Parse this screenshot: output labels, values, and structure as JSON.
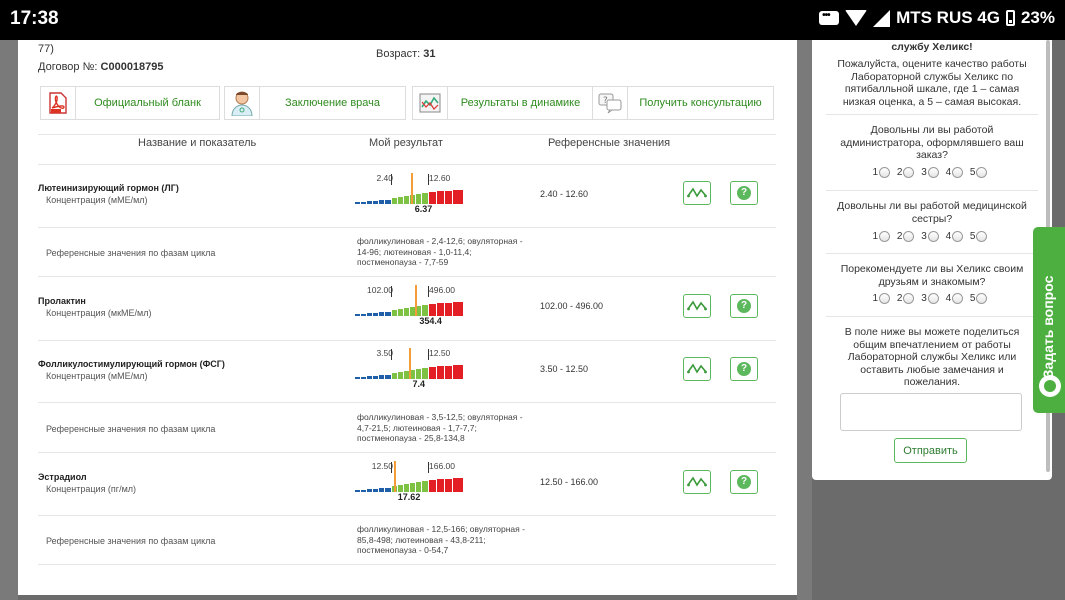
{
  "statusbar": {
    "time": "17:38",
    "carrier": "MTS RUS 4G",
    "battery": "23%"
  },
  "patient": {
    "top_line": "77)",
    "contract_label": "Договор №:",
    "contract_value": "С000018795",
    "age_label": "Возраст:",
    "age_value": "31"
  },
  "toolbar": [
    {
      "label": "Официальный бланк",
      "icon": "pdf-icon"
    },
    {
      "label": "Заключение врача",
      "icon": "doctor-icon"
    },
    {
      "label": "Результаты в динамике",
      "icon": "chart-icon"
    },
    {
      "label": "Получить консультацию",
      "icon": "chat-icon"
    }
  ],
  "columns": {
    "name": "Название и показатель",
    "result": "Мой результат",
    "reference": "Референсные значения"
  },
  "tests": [
    {
      "name": "Лютеинизирующий гормон (ЛГ)",
      "sub": "Концентрация (мМЕ/мл)",
      "low": "2.40",
      "high": "12.60",
      "value": "6.37",
      "value_fraction": 0.52,
      "reference": "2.40 - 12.60",
      "phase_label": "Референсные значения по фазам цикла",
      "phase_text": "фолликулиновая - 2,4-12,6; овуляторная - 14-96; лютеиновая - 1,0-11,4; постменопауза - 7,7-59"
    },
    {
      "name": "Пролактин",
      "sub": "Концентрация (мкМЕ/мл)",
      "low": "102.00",
      "high": "496.00",
      "value": "354.4",
      "value_fraction": 0.65,
      "reference": "102.00 - 496.00"
    },
    {
      "name": "Фолликулостимулирующий гормон (ФСГ)",
      "sub": "Концентрация (мМЕ/мл)",
      "low": "3.50",
      "high": "12.50",
      "value": "7.4",
      "value_fraction": 0.46,
      "reference": "3.50 - 12.50",
      "phase_label": "Референсные значения по фазам цикла",
      "phase_text": "фолликулиновая - 3,5-12,5; овуляторная - 4,7-21,5; лютеиновая - 1,7-7,7; постменопауза - 25,8-134,8"
    },
    {
      "name": "Эстрадиол",
      "sub": "Концентрация (пг/мл)",
      "low": "12.50",
      "high": "166.00",
      "value": "17.62",
      "value_fraction": 0.05,
      "reference": "12.50 - 166.00",
      "phase_label": "Референсные значения по фазам цикла",
      "phase_text": "фолликулиновая - 12,5-166; овуляторная - 85,8-498; лютеиновая - 43,8-211; постменопауза - 0-54,7"
    }
  ],
  "actions": {
    "help_glyph": "?"
  },
  "sidebar": {
    "heading": "службу Хеликс!",
    "intro": "Пожалуйста, оцените качество работы Лабораторной службы Хеликс по пятибалльной шкале, где 1 – самая низкая оценка, а 5 – самая высокая.",
    "questions": [
      "Довольны ли вы работой администратора, оформлявшего ваш заказ?",
      "Довольны ли вы работой медицинской сестры?",
      "Порекомендуете ли вы Хеликс своим друзьям и знакомым?"
    ],
    "rating_values": [
      "1",
      "2",
      "3",
      "4",
      "5"
    ],
    "feedback_prompt": "В поле ниже вы можете поделиться общим впечатлением от работы Лабораторной службы Хеликс или оставить любые замечания и пожелания.",
    "send_label": "Отправить"
  },
  "ask_tab": {
    "label": "Задать вопрос"
  },
  "colors": {
    "accent_green": "#5cb85c",
    "low_blue": "#1f5fa8",
    "norm_green": "#7dc242",
    "high_red": "#e31e24",
    "pointer_orange": "#f39c3a"
  }
}
